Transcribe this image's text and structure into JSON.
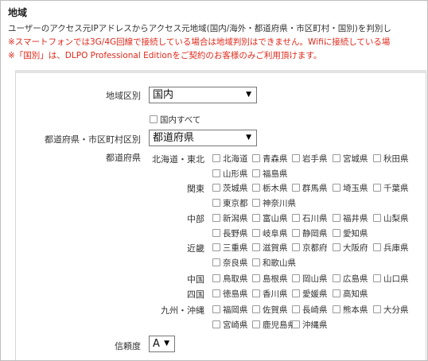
{
  "header": {
    "title": "地域",
    "line1": "ユーザーのアクセス元IPアドレスからアクセス元地域(国内/海外・都道府県・市区町村・国別)を判別し",
    "line2": "※スマートフォンでは3G/4G回線で接続している場合は地域判別はできません。Wifiに接続している場",
    "line3": "※「国別」は、DLPO Professional Editionをご契約のお客様のみご利用頂けます。"
  },
  "form": {
    "region_type_label": "地域区別",
    "region_type_value": "国内",
    "domestic_all_label": "国内すべて",
    "pref_city_label": "都道府県・市区町村区別",
    "pref_city_value": "都道府県",
    "prefectures_label": "都道府県",
    "reliability_label": "信頼度",
    "reliability_value": "A"
  },
  "regions": [
    {
      "name": "北海道・東北",
      "rows": [
        [
          "北海道",
          "青森県",
          "岩手県",
          "宮城県",
          "秋田県"
        ],
        [
          "山形県",
          "福島県"
        ]
      ]
    },
    {
      "name": "関東",
      "rows": [
        [
          "茨城県",
          "栃木県",
          "群馬県",
          "埼玉県",
          "千葉県"
        ],
        [
          "東京都",
          "神奈川県"
        ]
      ]
    },
    {
      "name": "中部",
      "rows": [
        [
          "新潟県",
          "富山県",
          "石川県",
          "福井県",
          "山梨県"
        ],
        [
          "長野県",
          "岐阜県",
          "静岡県",
          "愛知県"
        ]
      ]
    },
    {
      "name": "近畿",
      "rows": [
        [
          "三重県",
          "滋賀県",
          "京都府",
          "大阪府",
          "兵庫県"
        ],
        [
          "奈良県",
          "和歌山県"
        ]
      ]
    },
    {
      "name": "中国",
      "rows": [
        [
          "鳥取県",
          "島根県",
          "岡山県",
          "広島県",
          "山口県"
        ]
      ]
    },
    {
      "name": "四国",
      "rows": [
        [
          "徳島県",
          "香川県",
          "愛媛県",
          "高知県"
        ]
      ]
    },
    {
      "name": "九州・沖縄",
      "rows": [
        [
          "福岡県",
          "佐賀県",
          "長崎県",
          "熊本県",
          "大分県"
        ],
        [
          "宮崎県",
          "鹿児島県",
          "沖縄県"
        ]
      ]
    }
  ]
}
